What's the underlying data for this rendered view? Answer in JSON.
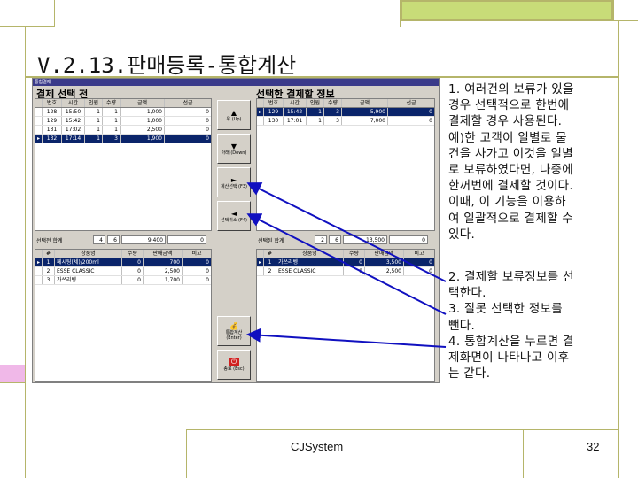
{
  "slide": {
    "title": "V.2.13.판매등록-통합계산",
    "footer": "CJSystem",
    "page_number": "32"
  },
  "app": {
    "window_title": "통합결제",
    "left_panel_title": "결제 선택 전",
    "right_panel_title": "선택한 결제할 정보",
    "columns": [
      "번호",
      "시간",
      "인원",
      "수량",
      "금액",
      "선금"
    ],
    "left_rows": [
      [
        "128",
        "15:50",
        "1",
        "1",
        "1,000",
        "0"
      ],
      [
        "129",
        "15:42",
        "1",
        "1",
        "1,000",
        "0"
      ],
      [
        "131",
        "17:02",
        "1",
        "1",
        "2,500",
        "0"
      ],
      [
        "132",
        "17:14",
        "1",
        "3",
        "1,900",
        "0"
      ]
    ],
    "right_rows": [
      [
        "129",
        "15:42",
        "1",
        "3",
        "5,900",
        "0"
      ],
      [
        "130",
        "17:01",
        "1",
        "3",
        "7,000",
        "0"
      ]
    ],
    "left_summary": {
      "label": "선택전 합계",
      "people": "4",
      "qty": "6",
      "amount": "9,400",
      "deposit": "0"
    },
    "right_summary": {
      "label": "선택된 합계",
      "people": "2",
      "qty": "6",
      "amount": "13,500",
      "deposit": "0"
    },
    "item_columns": [
      "#",
      "상품명",
      "수량",
      "판매금액",
      "비고"
    ],
    "left_items": [
      [
        "1",
        "페시팅(세)/200ml",
        "0",
        "700",
        "0"
      ],
      [
        "2",
        "ESSE CLASSIC",
        "0",
        "2,500",
        "0"
      ],
      [
        "3",
        "가쓰리벵",
        "0",
        "1,700",
        "0"
      ]
    ],
    "right_items": [
      [
        "1",
        "가쓰리벵",
        "0",
        "3,500",
        "0"
      ],
      [
        "2",
        "ESSE CLASSIC",
        "0",
        "2,500",
        "0"
      ]
    ],
    "buttons": {
      "up": "위 (Up)",
      "down": "아래 (Down)",
      "select": "계산선택 (F3)",
      "release": "선택취소 (F4)",
      "merge": "통합계산 (Enter)",
      "exit": "종료 (Esc)"
    }
  },
  "explanation": {
    "p1": [
      "1. 여러건의 보류가 있을",
      "경우 선택적으로 한번에",
      "결제할 경우 사용된다.",
      "예)한 고객이 일별로 물",
      "건을 사가고 이것을 일별",
      "로 보류하였다면, 나중에",
      "한꺼번에 결제할 것이다.",
      "이때, 이 기능을 이용하",
      "여 일괄적으로 결제할 수",
      "있다."
    ],
    "p2": [
      "2. 결제할 보류정보를 선",
      "택한다.",
      "3. 잘못 선택한 정보를",
      "뺀다.",
      "4. 통합계산을 누르면 결",
      "제화면이 나타나고 이후",
      "는 같다."
    ]
  },
  "colors": {
    "selection": "#0a246a",
    "arrow": "#1010c0",
    "accent_green": "#c8dc78",
    "accent_pink": "#f0b8e8"
  }
}
